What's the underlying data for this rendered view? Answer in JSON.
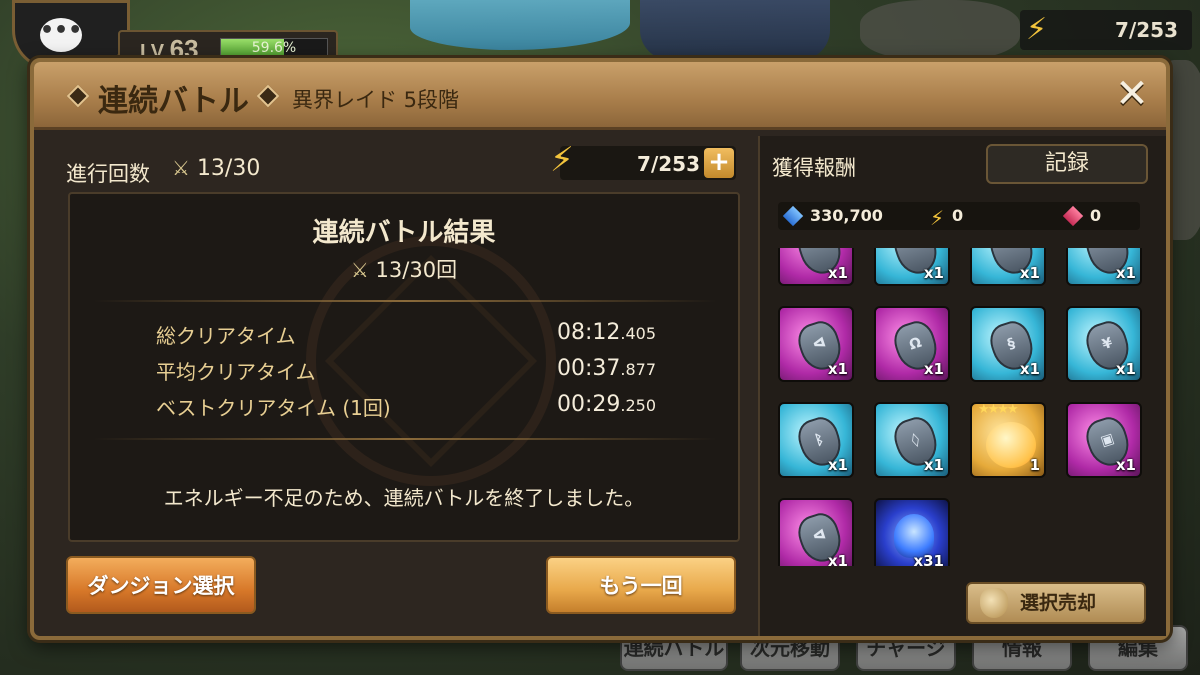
{
  "hud": {
    "level_label": "LV",
    "level": "63",
    "exp_percent_text": "59.6%",
    "exp_fraction": 0.596,
    "energy": "7/253"
  },
  "dialog": {
    "title": "連続バトル",
    "subtitle": "異界レイド 5段階",
    "close_label": "✕"
  },
  "left": {
    "progress_label": "進行回数",
    "progress_value": "13/30",
    "energy_value": "7/253",
    "plus_label": "+",
    "result": {
      "title": "連続バトル結果",
      "count": "13/30回",
      "rows": [
        {
          "label": "総クリアタイム",
          "time_main": "08:12",
          "time_ms": ".405"
        },
        {
          "label": "平均クリアタイム",
          "time_main": "00:37",
          "time_ms": ".877"
        },
        {
          "label": "ベストクリアタイム (1回)",
          "time_main": "00:29",
          "time_ms": ".250"
        }
      ],
      "message": "エネルギー不足のため、連続バトルを終了しました。"
    },
    "dungeon_button": "ダンジョン選択",
    "again_button": "もう一回"
  },
  "right": {
    "rewards_title": "獲得報酬",
    "record_button": "記録",
    "currencies": [
      {
        "icon": "crystal-icon",
        "value": "330,700"
      },
      {
        "icon": "energy-icon",
        "value": "0"
      },
      {
        "icon": "red-crystal-icon",
        "value": "0"
      }
    ],
    "rewards": [
      {
        "color": "pink",
        "kind": "rune",
        "symbol": "",
        "qty": "x1"
      },
      {
        "color": "blue",
        "kind": "rune",
        "symbol": "",
        "qty": "x1"
      },
      {
        "color": "blue",
        "kind": "rune",
        "symbol": "",
        "qty": "x1"
      },
      {
        "color": "blue",
        "kind": "rune",
        "symbol": "",
        "qty": "x1"
      },
      {
        "color": "pink",
        "kind": "rune",
        "symbol": "ᐊ",
        "qty": "x1"
      },
      {
        "color": "pink",
        "kind": "rune",
        "symbol": "Ω",
        "qty": "x1"
      },
      {
        "color": "blue",
        "kind": "rune",
        "symbol": "§",
        "qty": "x1"
      },
      {
        "color": "blue",
        "kind": "rune",
        "symbol": "¥",
        "qty": "x1"
      },
      {
        "color": "blue",
        "kind": "rune",
        "symbol": "ᛒ",
        "qty": "x1"
      },
      {
        "color": "blue",
        "kind": "rune",
        "symbol": "◊",
        "qty": "x1"
      },
      {
        "color": "gold",
        "kind": "monster",
        "symbol": "★★★★",
        "qty": "1"
      },
      {
        "color": "pink",
        "kind": "rune",
        "symbol": "▣",
        "qty": "x1"
      },
      {
        "color": "pink",
        "kind": "rune",
        "symbol": "ᐊ",
        "qty": "x1"
      },
      {
        "color": "void",
        "kind": "essence",
        "symbol": "",
        "qty": "x31"
      }
    ],
    "sell_button": "選択売却"
  },
  "bottom_tabs": [
    "連続バトル",
    "次元移動",
    "チャージ",
    "情報",
    "編集"
  ]
}
